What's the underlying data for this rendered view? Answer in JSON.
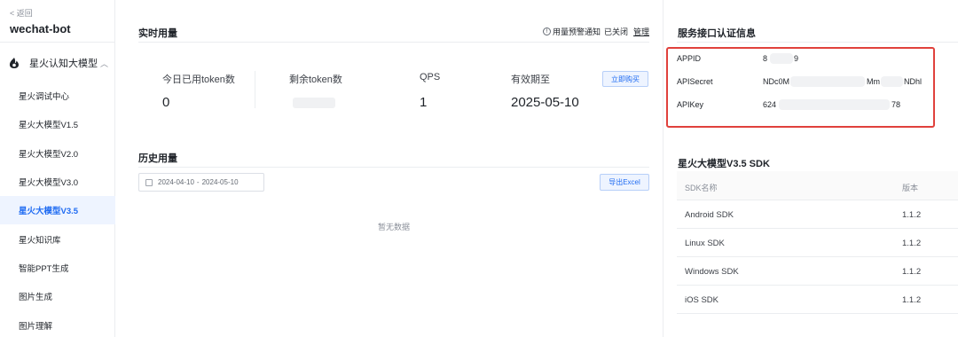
{
  "sidebar": {
    "back_label": "< 返回",
    "app_name": "wechat-bot",
    "group_label": "星火认知大模型",
    "items": [
      {
        "label": "星火调试中心"
      },
      {
        "label": "星火大模型V1.5"
      },
      {
        "label": "星火大模型V2.0"
      },
      {
        "label": "星火大模型V3.0"
      },
      {
        "label": "星火大模型V3.5",
        "active": true
      },
      {
        "label": "星火知识库"
      },
      {
        "label": "智能PPT生成"
      },
      {
        "label": "图片生成"
      },
      {
        "label": "图片理解"
      }
    ]
  },
  "usage": {
    "title": "实时用量",
    "alert_label": "用量预警通知",
    "alert_status": "已关闭",
    "manage_label": "管理",
    "stats": [
      {
        "label": "今日已用token数",
        "value": "0"
      },
      {
        "label": "剩余token数",
        "value": ""
      },
      {
        "label": "QPS",
        "value": "1"
      },
      {
        "label": "有效期至",
        "value": "2025-05-10"
      }
    ],
    "buy_label": "立即购买"
  },
  "history": {
    "title": "历史用量",
    "date_start": "2024-04-10",
    "date_sep": "-",
    "date_end": "2024-05-10",
    "export_label": "导出Excel",
    "empty_text": "暂无数据"
  },
  "credentials": {
    "title": "服务接口认证信息",
    "rows": [
      {
        "key": "APPID",
        "value_prefix": "8",
        "value_suffix": "9"
      },
      {
        "key": "APISecret",
        "value_prefix": "NDc0M",
        "value_mid": "Mm",
        "value_suffix": "NDhl"
      },
      {
        "key": "APIKey",
        "value_prefix": "624",
        "value_suffix": "78"
      }
    ]
  },
  "sdk": {
    "title": "星火大模型V3.5 SDK",
    "col_name": "SDK名称",
    "col_version": "版本",
    "rows": [
      {
        "name": "Android SDK",
        "version": "1.1.2"
      },
      {
        "name": "Linux SDK",
        "version": "1.1.2"
      },
      {
        "name": "Windows SDK",
        "version": "1.1.2"
      },
      {
        "name": "iOS SDK",
        "version": "1.1.2"
      }
    ]
  },
  "colors": {
    "accent": "#1f6bf2",
    "highlight_border": "#e0413c",
    "active_bg": "#eef4ff"
  },
  "icons": [
    "spark-logo-icon",
    "chevron-up-icon",
    "bell-icon",
    "calendar-icon"
  ]
}
